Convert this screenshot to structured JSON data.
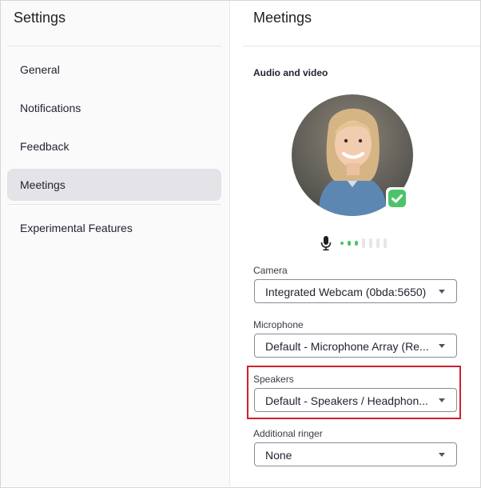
{
  "sidebar": {
    "title": "Settings",
    "items": [
      {
        "label": "General"
      },
      {
        "label": "Notifications"
      },
      {
        "label": "Feedback"
      },
      {
        "label": "Meetings",
        "active": true
      },
      {
        "label": "Experimental Features"
      }
    ]
  },
  "main": {
    "title": "Meetings",
    "section": "Audio and video",
    "mic_level": {
      "active_bars": 3,
      "total_bars": 7
    },
    "fields": {
      "camera": {
        "label": "Camera",
        "value": "Integrated Webcam (0bda:5650)"
      },
      "microphone": {
        "label": "Microphone",
        "value": "Default - Microphone Array (Re..."
      },
      "speakers": {
        "label": "Speakers",
        "value": "Default - Speakers / Headphon..."
      },
      "ringer": {
        "label": "Additional ringer",
        "value": "None"
      }
    }
  },
  "colors": {
    "active_nav_bg": "#e3e3e8",
    "status_green": "#4cc36b",
    "highlight_red": "#d0202e"
  }
}
